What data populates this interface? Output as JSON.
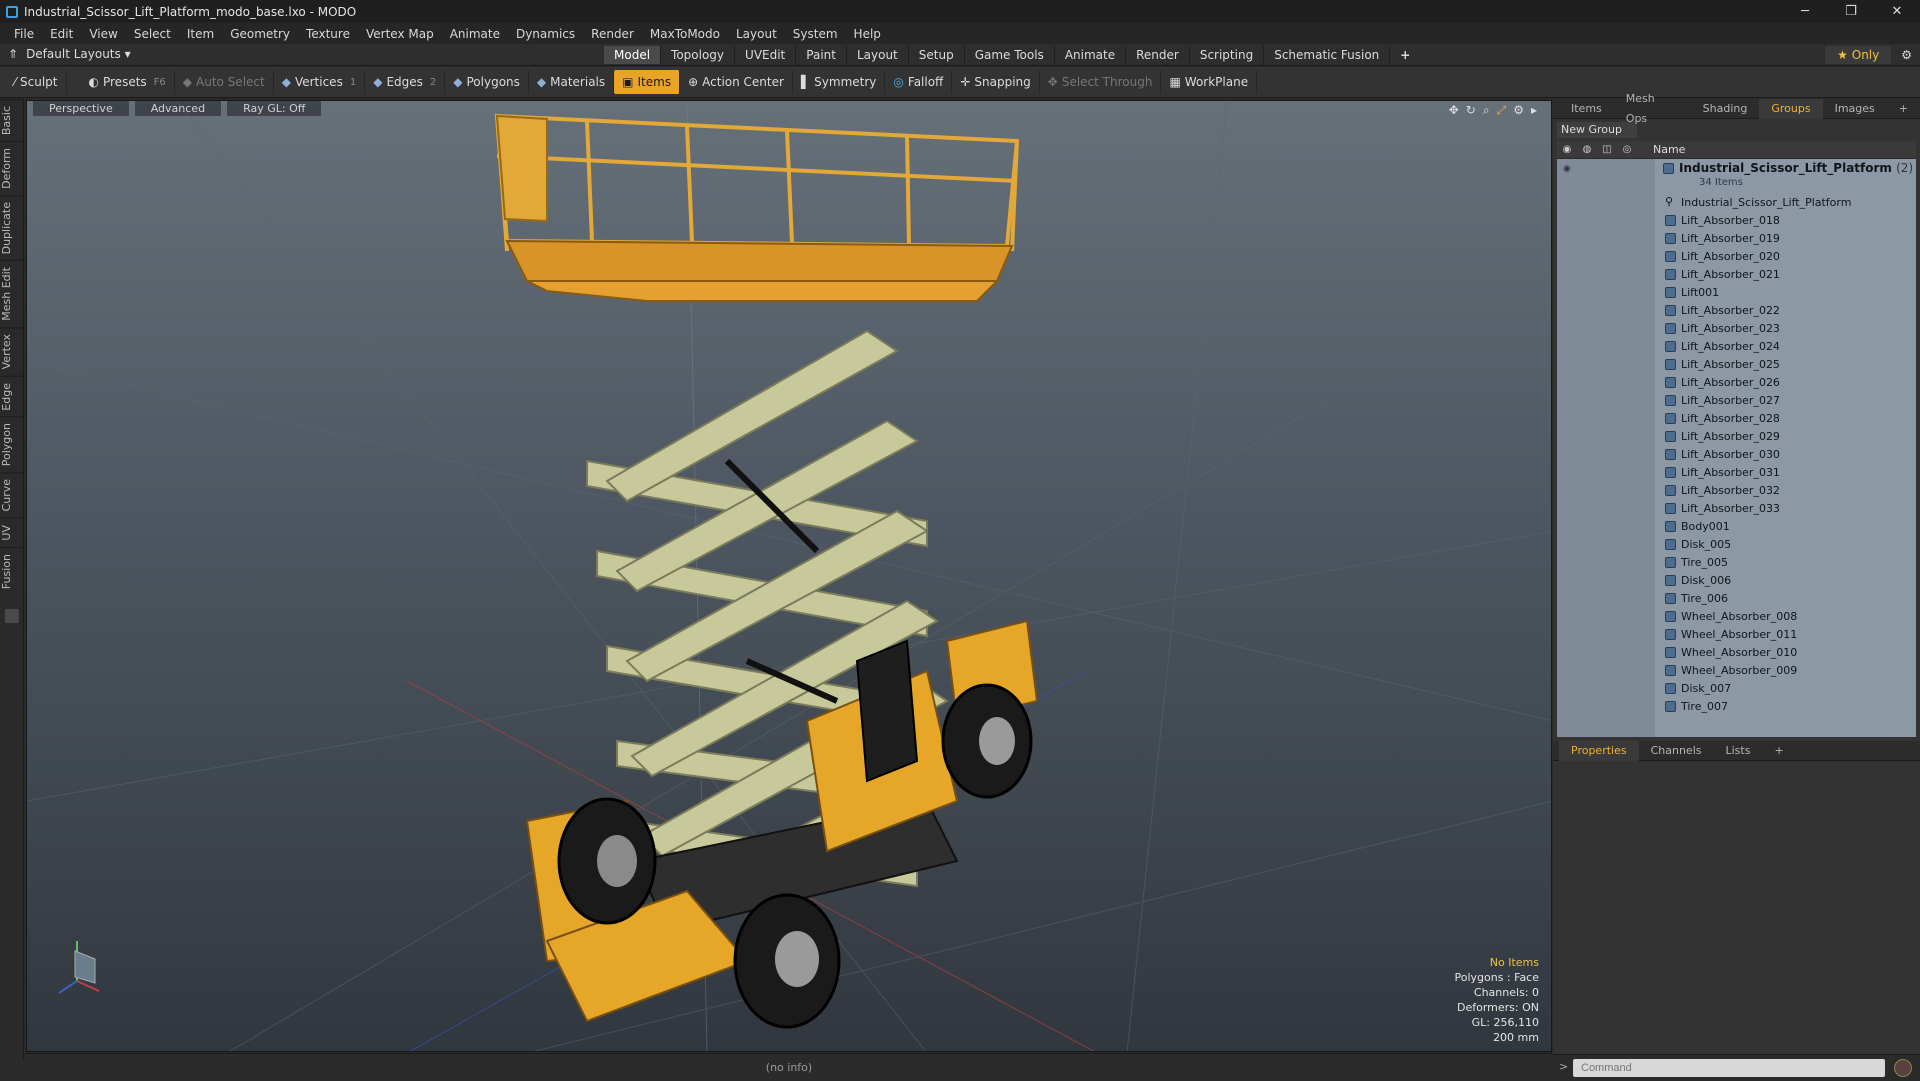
{
  "window": {
    "title": "Industrial_Scissor_Lift_Platform_modo_base.lxo - MODO",
    "min": "─",
    "max": "❐",
    "close": "✕"
  },
  "menu": [
    "File",
    "Edit",
    "View",
    "Select",
    "Item",
    "Geometry",
    "Texture",
    "Vertex Map",
    "Animate",
    "Dynamics",
    "Render",
    "MaxToModo",
    "Layout",
    "System",
    "Help"
  ],
  "layoutbar": {
    "layout_label": "Default Layouts ▾",
    "tabs": [
      "Model",
      "Topology",
      "UVEdit",
      "Paint",
      "Layout",
      "Setup",
      "Game Tools",
      "Animate",
      "Render",
      "Scripting",
      "Schematic Fusion"
    ],
    "active_tab": "Model",
    "add": "+",
    "only": "★  Only"
  },
  "toolbar": {
    "sculpt": "Sculpt",
    "presets": "Presets",
    "presets_key": "F6",
    "auto_select": "Auto Select",
    "vertices": "Vertices",
    "vertices_key": "1",
    "edges": "Edges",
    "edges_key": "2",
    "polygons": "Polygons",
    "materials": "Materials",
    "items": "Items",
    "action_center": "Action Center",
    "symmetry": "Symmetry",
    "falloff": "Falloff",
    "snapping": "Snapping",
    "select_through": "Select Through",
    "workplane": "WorkPlane"
  },
  "left_tabs": [
    "Basic",
    "Deform",
    "Duplicate",
    "Mesh Edit",
    "Vertex",
    "Edge",
    "Polygon",
    "Curve",
    "UV",
    "Fusion"
  ],
  "viewport": {
    "header": [
      "Perspective",
      "Advanced",
      "Ray GL: Off"
    ],
    "info": {
      "status": "No Items",
      "polygons": "Polygons : Face",
      "channels": "Channels: 0",
      "deformers": "Deformers: ON",
      "gl": "GL: 256,110",
      "scale": "200 mm"
    }
  },
  "statusbar": "(no info)",
  "panel_top": {
    "tabs": [
      "Items",
      "Mesh Ops",
      "Shading",
      "Groups",
      "Images"
    ],
    "active_tab": "Groups",
    "new_group": "New Group",
    "name_col": "Name",
    "root": {
      "name": "Industrial_Scissor_Lift_Platform",
      "count_badge": "(2)",
      "sub": "34 Items"
    },
    "items": [
      "Industrial_Scissor_Lift_Platform",
      "Lift_Absorber_018",
      "Lift_Absorber_019",
      "Lift_Absorber_020",
      "Lift_Absorber_021",
      "Lift001",
      "Lift_Absorber_022",
      "Lift_Absorber_023",
      "Lift_Absorber_024",
      "Lift_Absorber_025",
      "Lift_Absorber_026",
      "Lift_Absorber_027",
      "Lift_Absorber_028",
      "Lift_Absorber_029",
      "Lift_Absorber_030",
      "Lift_Absorber_031",
      "Lift_Absorber_032",
      "Lift_Absorber_033",
      "Body001",
      "Disk_005",
      "Tire_005",
      "Disk_006",
      "Tire_006",
      "Wheel_Absorber_008",
      "Wheel_Absorber_011",
      "Wheel_Absorber_010",
      "Wheel_Absorber_009",
      "Disk_007",
      "Tire_007"
    ]
  },
  "panel_bottom": {
    "tabs": [
      "Properties",
      "Channels",
      "Lists"
    ],
    "active_tab": "Properties",
    "command_placeholder": "Command",
    "prompt": ">"
  }
}
